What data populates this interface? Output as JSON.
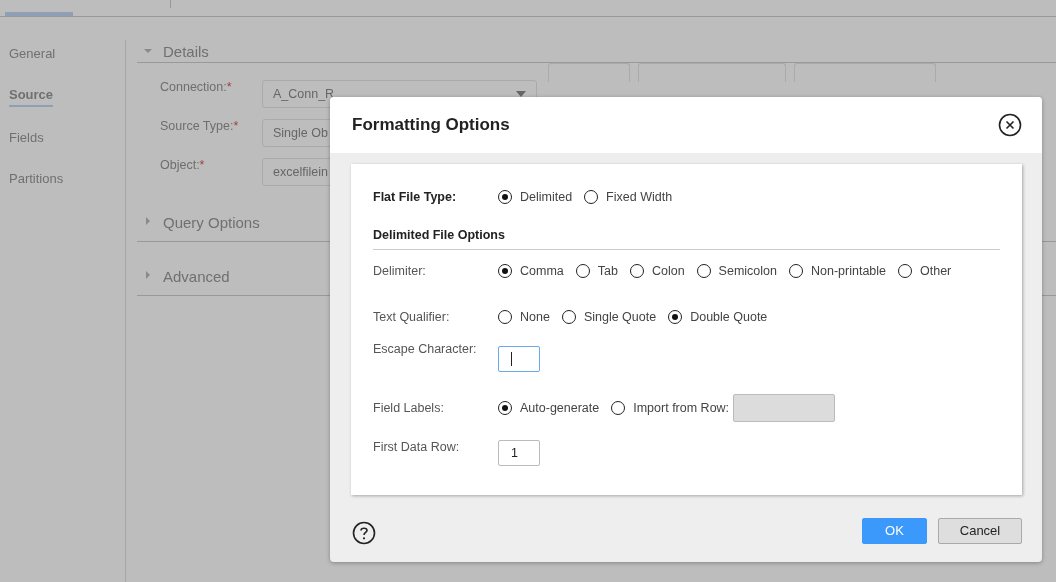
{
  "side_nav": [
    {
      "label": "General",
      "selected": false
    },
    {
      "label": "Source",
      "selected": true
    },
    {
      "label": "Fields",
      "selected": false
    },
    {
      "label": "Partitions",
      "selected": false
    }
  ],
  "details": {
    "title": "Details",
    "expanded": true,
    "fields": [
      {
        "label": "Connection:",
        "required_mark": "*",
        "value": "A_Conn_R",
        "dropdown": true
      },
      {
        "label": "Source Type:",
        "required_mark": "*",
        "value": "Single Ob",
        "dropdown": false
      },
      {
        "label": "Object:",
        "required_mark": "*",
        "value": "excelfilein",
        "dropdown": false
      }
    ]
  },
  "sections": [
    {
      "title": "Query Options",
      "expanded": false
    },
    {
      "title": "Advanced",
      "expanded": false
    }
  ],
  "dialog": {
    "title": "Formatting Options",
    "file_type": {
      "label": "Flat File Type:",
      "options": [
        {
          "label": "Delimited",
          "selected": true
        },
        {
          "label": "Fixed Width",
          "selected": false
        }
      ]
    },
    "section_title": "Delimited File Options",
    "rows": [
      {
        "kind": "radio",
        "label": "Delimiter:",
        "options": [
          {
            "label": "Comma",
            "selected": true
          },
          {
            "label": "Tab",
            "selected": false
          },
          {
            "label": "Colon",
            "selected": false
          },
          {
            "label": "Semicolon",
            "selected": false
          },
          {
            "label": "Non-printable",
            "selected": false
          },
          {
            "label": "Other",
            "selected": false
          }
        ]
      },
      {
        "kind": "radio",
        "label": "Text Qualifier:",
        "options": [
          {
            "label": "None",
            "selected": false
          },
          {
            "label": "Single Quote",
            "selected": false
          },
          {
            "label": "Double Quote",
            "selected": true
          }
        ]
      },
      {
        "kind": "input",
        "label": "Escape Character:",
        "focused": true
      },
      {
        "kind": "radio_input",
        "label": "Field Labels:",
        "options": [
          {
            "label": "Auto-generate",
            "selected": true
          },
          {
            "label": "Import from Row:",
            "selected": false
          }
        ],
        "input_disabled": true
      },
      {
        "kind": "input",
        "label": "First Data Row:",
        "value": "1",
        "focused": false
      }
    ],
    "buttons": [
      {
        "label": "OK",
        "primary": true
      },
      {
        "label": "Cancel",
        "primary": false
      }
    ]
  }
}
